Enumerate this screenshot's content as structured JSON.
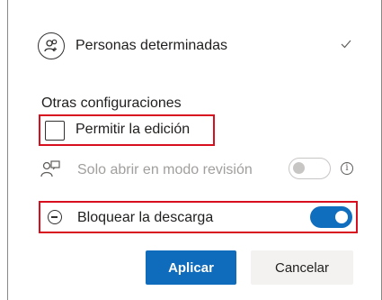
{
  "people": {
    "label": "Personas determinadas",
    "icon": "people-icon",
    "check_icon": "checkmark-icon"
  },
  "settings": {
    "title": "Otras configuraciones",
    "allow_edit": {
      "label": "Permitir la edición",
      "checked": false
    },
    "review_mode": {
      "label": "Solo abrir en modo revisión",
      "enabled": false,
      "on": false,
      "info_icon": "info-icon"
    },
    "block_download": {
      "label": "Bloquear la descarga",
      "on": true
    }
  },
  "buttons": {
    "apply": "Aplicar",
    "cancel": "Cancelar"
  },
  "colors": {
    "accent": "#0f6cbd",
    "highlight": "#d70f1e",
    "disabled_text": "#a19f9d"
  }
}
